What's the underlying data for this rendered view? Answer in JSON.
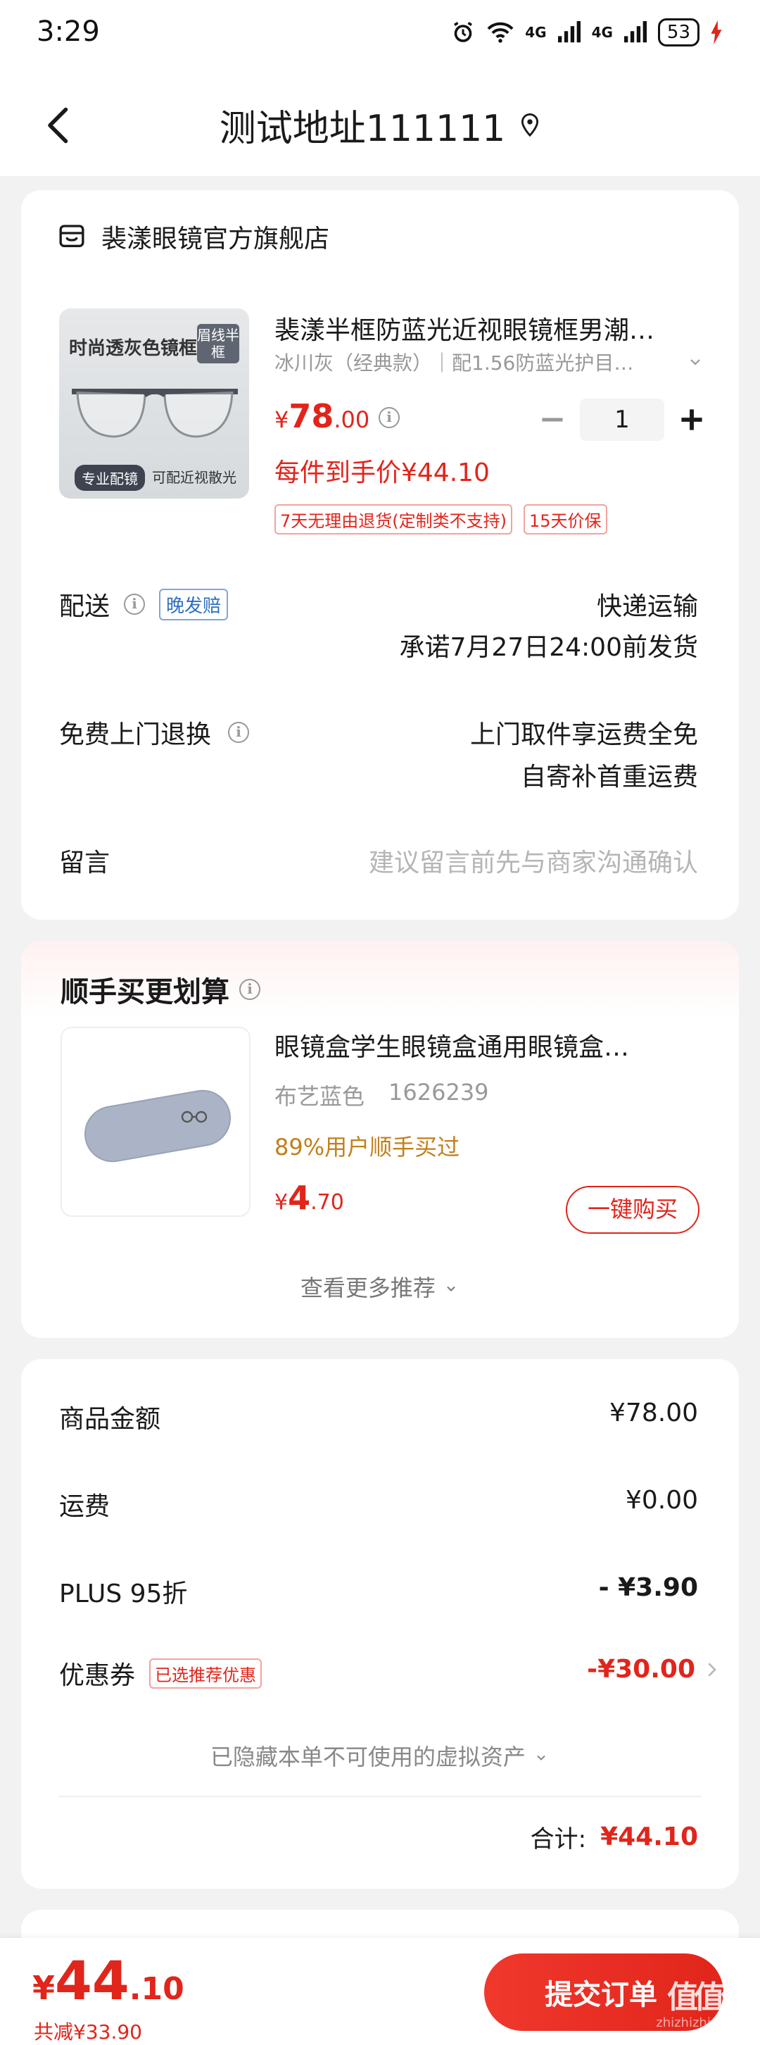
{
  "status": {
    "time": "3:29",
    "net1": "4G",
    "net2": "4G",
    "battery": "53"
  },
  "nav": {
    "title": "测试地址111111"
  },
  "store": {
    "name": "裴漾眼镜官方旗舰店"
  },
  "product": {
    "image_text_top": "时尚透灰色镜框",
    "image_badge": "眉线半框",
    "image_tag1": "专业配镜",
    "image_tag2": "可配近视散光",
    "title": "裴漾半框防蓝光近视眼镜框男潮…",
    "spec": "冰川灰（经典款）｜配1.56防蓝光护目…",
    "currency": "¥",
    "price_int": "78",
    "price_dec": ".00",
    "quantity": "1",
    "final_price": "每件到手价¥44.10",
    "tags": [
      "7天无理由退货(定制类不支持)",
      "15天价保"
    ]
  },
  "delivery": {
    "label": "配送",
    "badge": "晚发赔",
    "method": "快递运输",
    "promise": "承诺7月27日24:00前发货"
  },
  "return_service": {
    "label": "免费上门退换",
    "line1": "上门取件享运费全免",
    "line2": "自寄补首重运费"
  },
  "message": {
    "label": "留言",
    "placeholder": "建议留言前先与商家沟通确认"
  },
  "recommend": {
    "title": "顺手买更划算",
    "item_title": "眼镜盒学生眼镜盒通用眼镜盒…",
    "item_spec": "布艺蓝色",
    "item_code": "1626239",
    "item_hint": "89%用户顺手买过",
    "currency": "¥",
    "price_int": "4",
    "price_dec": ".70",
    "buy_label": "一键购买",
    "more_label": "查看更多推荐"
  },
  "summary": {
    "goods_label": "商品金额",
    "goods_value": "¥78.00",
    "freight_label": "运费",
    "freight_value": "¥0.00",
    "plus_label": "PLUS 95折",
    "plus_value": "- ¥3.90",
    "coupon_label": "优惠券",
    "coupon_badge": "已选推荐优惠",
    "coupon_value": "-¥30.00",
    "hidden_label": "已隐藏本单不可使用的虚拟资产",
    "total_label": "合计:",
    "total_value": "¥44.10"
  },
  "bottom": {
    "currency": "¥",
    "price_int": "44",
    "price_dec": ".10",
    "saved": "共减¥33.90",
    "submit": "提交订单"
  },
  "watermark": {
    "text": "值值值",
    "sub": "zhizhizhi.com"
  }
}
